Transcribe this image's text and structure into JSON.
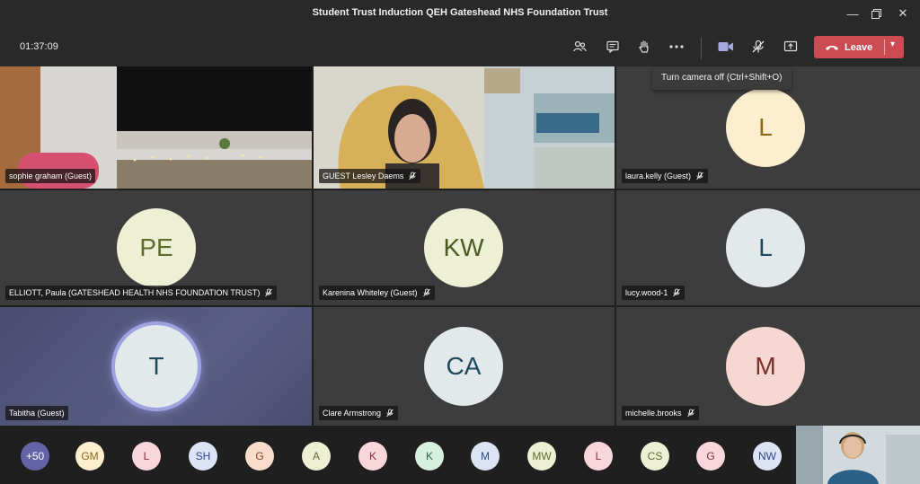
{
  "window": {
    "title": "Student Trust Induction QEH Gateshead NHS Foundation Trust"
  },
  "toolbar": {
    "timer": "01:37:09",
    "leave_label": "Leave",
    "tooltip": "Turn camera off (Ctrl+Shift+O)",
    "icons": [
      "participants-icon",
      "chat-icon",
      "raise-hand-icon",
      "more-icon",
      "camera-icon",
      "mic-off-icon",
      "share-icon"
    ]
  },
  "tiles": [
    {
      "name": "sophie graham (Guest)",
      "type": "video"
    },
    {
      "name": "GUEST Lesley Daems",
      "type": "video"
    },
    {
      "name": "laura.kelly (Guest)",
      "initials": "L",
      "avatar_bg": "#fbefd0",
      "avatar_fg": "#8b6b1a"
    },
    {
      "name": "ELLIOTT, Paula (GATESHEAD HEALTH NHS FOUNDATION TRUST)",
      "initials": "PE",
      "avatar_bg": "#eef0d6",
      "avatar_fg": "#5c6b2e"
    },
    {
      "name": "Karenina Whiteley (Guest)",
      "initials": "KW",
      "avatar_bg": "#eef0d6",
      "avatar_fg": "#4a5a25"
    },
    {
      "name": "lucy.wood-1",
      "initials": "L",
      "avatar_bg": "#e3e8ea",
      "avatar_fg": "#1e4b5c"
    },
    {
      "name": "Tabitha (Guest)",
      "initials": "T",
      "avatar_bg": "#e3e8ea",
      "avatar_fg": "#1e4b5c"
    },
    {
      "name": "Clare Armstrong",
      "initials": "CA",
      "avatar_bg": "#e3e8ea",
      "avatar_fg": "#1e4b5c"
    },
    {
      "name": "michelle.brooks",
      "initials": "M",
      "avatar_bg": "#f6d7d2",
      "avatar_fg": "#7a2f2a"
    }
  ],
  "overflow": [
    {
      "label": "+50",
      "bg": "#6264a7",
      "fg": "#ffffff"
    },
    {
      "label": "GM",
      "bg": "#fbefd0",
      "fg": "#8b6b1a"
    },
    {
      "label": "L",
      "bg": "#f7d6dc",
      "fg": "#8a2f45"
    },
    {
      "label": "SH",
      "bg": "#dbe3f5",
      "fg": "#2d4a86"
    },
    {
      "label": "G",
      "bg": "#f9dccb",
      "fg": "#8a3f1a"
    },
    {
      "label": "A",
      "bg": "#eef0d6",
      "fg": "#5c6b2e"
    },
    {
      "label": "K",
      "bg": "#f7d6dc",
      "fg": "#8a2f45"
    },
    {
      "label": "K",
      "bg": "#d7efe0",
      "fg": "#2b6b44"
    },
    {
      "label": "M",
      "bg": "#dbe3f5",
      "fg": "#2d4a86"
    },
    {
      "label": "MW",
      "bg": "#eef0d6",
      "fg": "#5c6b2e"
    },
    {
      "label": "L",
      "bg": "#f7d6dc",
      "fg": "#8a2f45"
    },
    {
      "label": "CS",
      "bg": "#eef0d6",
      "fg": "#5c6b2e"
    },
    {
      "label": "G",
      "bg": "#f7d6dc",
      "fg": "#8a2f45"
    },
    {
      "label": "NW",
      "bg": "#dbe3f5",
      "fg": "#2d4a86"
    }
  ],
  "colors": {
    "leave": "#cc4a51",
    "tile": "#3d3d3d",
    "background": "#1f1f1f"
  }
}
